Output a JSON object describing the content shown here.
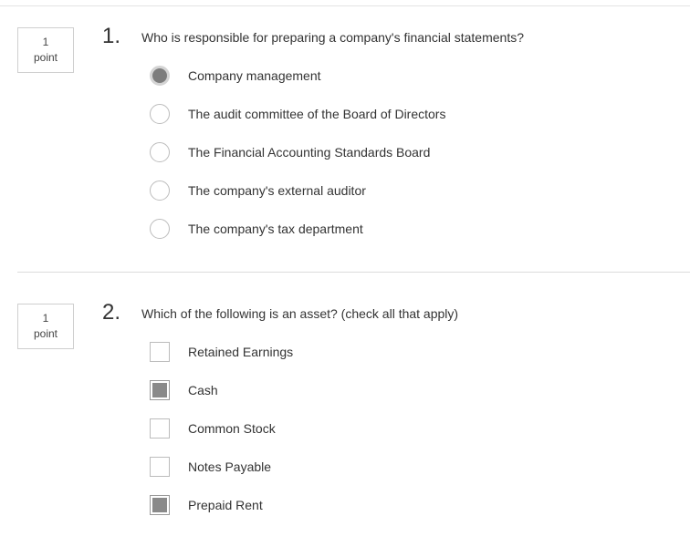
{
  "questions": [
    {
      "points_value": "1",
      "points_unit": "point",
      "number": "1.",
      "text": "Who is responsible for preparing a company's financial statements?",
      "input_type": "radio",
      "options": [
        {
          "label": "Company management",
          "selected": true
        },
        {
          "label": "The audit committee of the Board of Directors",
          "selected": false
        },
        {
          "label": "The Financial Accounting Standards Board",
          "selected": false
        },
        {
          "label": "The company's external auditor",
          "selected": false
        },
        {
          "label": "The company's tax department",
          "selected": false
        }
      ]
    },
    {
      "points_value": "1",
      "points_unit": "point",
      "number": "2.",
      "text": "Which of the following is an asset? (check all that apply)",
      "input_type": "checkbox",
      "options": [
        {
          "label": "Retained Earnings",
          "selected": false
        },
        {
          "label": "Cash",
          "selected": true
        },
        {
          "label": "Common Stock",
          "selected": false
        },
        {
          "label": "Notes Payable",
          "selected": false
        },
        {
          "label": "Prepaid Rent",
          "selected": true
        }
      ]
    }
  ],
  "colors": {
    "selected_fill": "#7d7d7d",
    "border": "#bcbcbc",
    "text": "#333333"
  }
}
